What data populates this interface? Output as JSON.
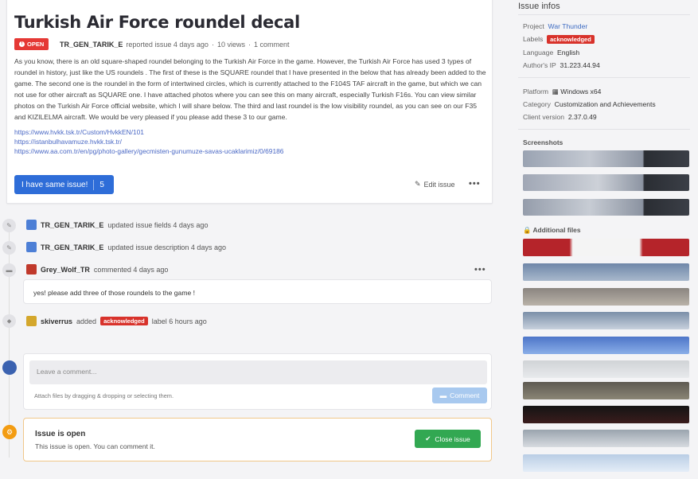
{
  "issue": {
    "title": "Turkish Air Force roundel decal",
    "status": "OPEN",
    "author": "TR_GEN_TARIK_E",
    "reported_text": "reported issue 4 days ago",
    "views": "10 views",
    "comments": "1 comment",
    "body": "As you know, there is an old square-shaped roundel belonging to the Turkish Air Force in the game. However, the Turkish Air Force has used 3 types of roundel in history, just like the US roundels . The first of these is the SQUARE roundel that I have presented in the below that has already been added to the game. The second one is the roundel in the form of intertwined circles, which is currently attached to the F104S TAF aircraft in the game, but which we can not use for other aircraft as SQUARE one. I have attached photos where you can see this on many aircraft, especially Turkish F16s. You can view similar photos on the Turkish Air Force official website, which I will share below. The third and last roundel is the low visibility roundel, as you can see on our F35 and KIZILELMA aircraft. We would be very pleased if you please add these 3 to our game.",
    "links": [
      "https://www.hvkk.tsk.tr/Custom/HvkkEN/101",
      "https://istanbulhavamuze.hvkk.tsk.tr/",
      "https://www.aa.com.tr/en/pg/photo-gallery/gecmisten-gunumuze-savas-ucaklarimiz/0/69186"
    ],
    "same_issue_label": "I have same issue!",
    "same_issue_count": "5",
    "edit_label": "Edit issue",
    "more_label": "•••"
  },
  "timeline": [
    {
      "user": "TR_GEN_TARIK_E",
      "text": "updated issue fields 4 days ago",
      "icon": "pencil-icon"
    },
    {
      "user": "TR_GEN_TARIK_E",
      "text": "updated issue description 4 days ago",
      "icon": "pencil-icon"
    },
    {
      "user": "Grey_Wolf_TR",
      "text": "commented 4 days ago",
      "icon": "comment-icon",
      "comment": "yes! please add three of those roundels to the game !"
    },
    {
      "user": "skiverrus",
      "pre": "added",
      "label": "acknowledged",
      "text": "label 6 hours ago",
      "icon": "tag-icon"
    }
  ],
  "new_comment": {
    "placeholder": "Leave a comment...",
    "hint": "Attach files by dragging & dropping or selecting them.",
    "button": "Comment"
  },
  "status_box": {
    "title": "Issue is open",
    "subtitle": "This issue is open. You can comment it.",
    "button": "Close issue"
  },
  "sidebar": {
    "title": "Issue infos",
    "project_key": "Project",
    "project_val": "War Thunder",
    "labels_key": "Labels",
    "labels_val": "acknowledged",
    "language_key": "Language",
    "language_val": "English",
    "ip_key": "Author's IP",
    "ip_val": "31.223.44.94",
    "platform_key": "Platform",
    "platform_val": "Windows x64",
    "category_key": "Category",
    "category_val": "Customization and Achievements",
    "client_key": "Client version",
    "client_val": "2.37.0.49",
    "screenshots_title": "Screenshots",
    "files_title": "Additional files"
  },
  "colors": {
    "accent": "#2e6dd8",
    "open_red": "#e53935",
    "label_red": "#d8322b",
    "green": "#32a852",
    "link": "#4a68c5"
  }
}
